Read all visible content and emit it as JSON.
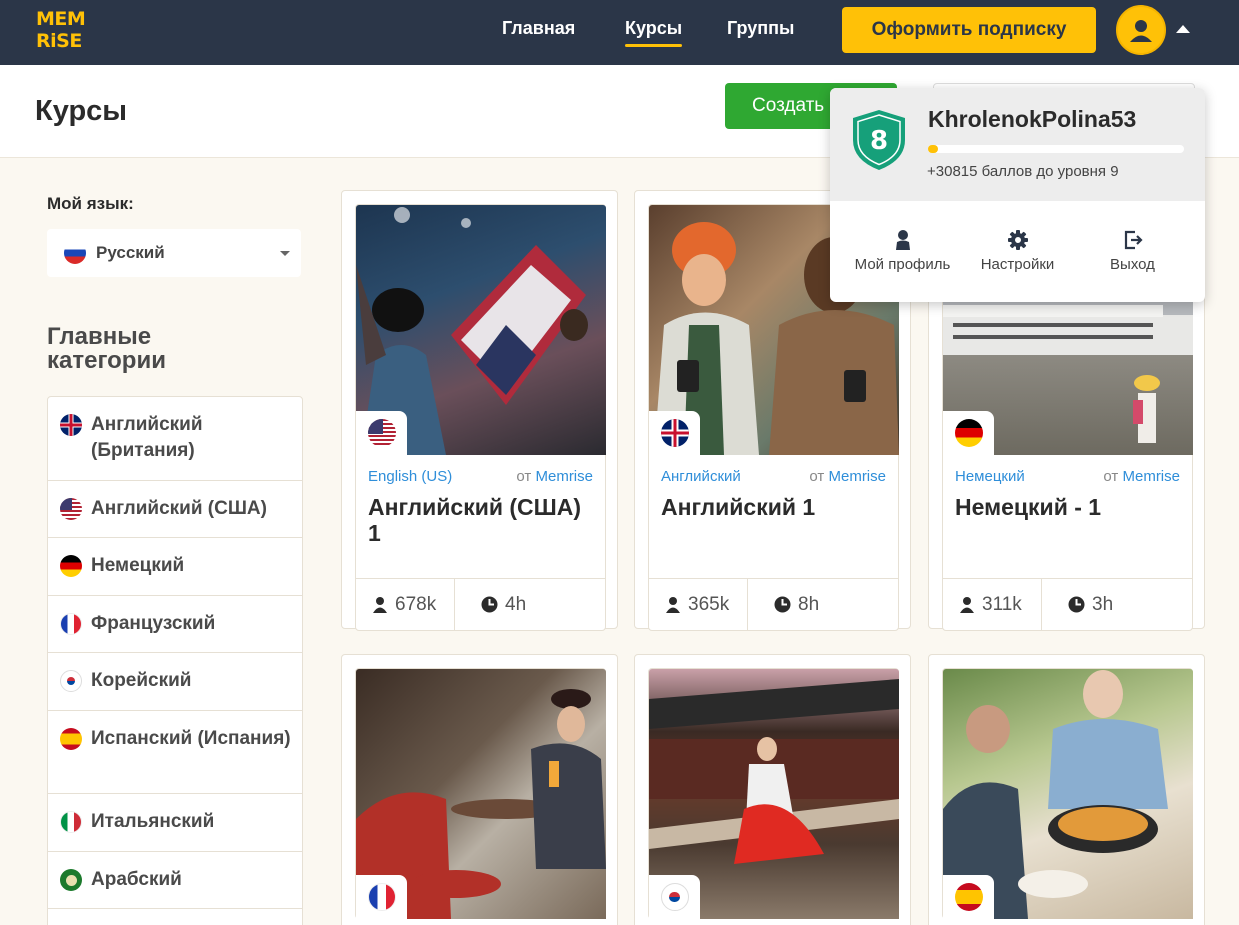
{
  "app": {
    "logo_text_line1": "MEM",
    "logo_text_line2": "RiSE",
    "nav": [
      {
        "label": "Главная",
        "active": false
      },
      {
        "label": "Курсы",
        "active": true
      },
      {
        "label": "Группы",
        "active": false
      }
    ],
    "subscribe_label": "Оформить подписку"
  },
  "page": {
    "title": "Курсы",
    "create_label": "Создать"
  },
  "sidebar": {
    "my_language_label": "Мой язык:",
    "selected_language": "Русский",
    "categories_title": "Главные категории",
    "categories": [
      {
        "label": "Английский (Британия)",
        "flag": "gb"
      },
      {
        "label": "Английский (США)",
        "flag": "us"
      },
      {
        "label": "Немецкий",
        "flag": "de"
      },
      {
        "label": "Французский",
        "flag": "fr"
      },
      {
        "label": "Корейский",
        "flag": "kr"
      },
      {
        "label": "Испанский (Испания)",
        "flag": "es"
      },
      {
        "label": "Итальянский",
        "flag": "it"
      },
      {
        "label": "Арабский",
        "flag": "ar"
      }
    ]
  },
  "courses": [
    {
      "category": "English (US)",
      "by_prefix": "от",
      "author": "Memrise",
      "name": "Английский (США) 1",
      "learners": "678k",
      "duration": "4h",
      "flag": "us"
    },
    {
      "category": "Английский",
      "by_prefix": "от",
      "author": "Memrise",
      "name": "Английский 1",
      "learners": "365k",
      "duration": "8h",
      "flag": "gb"
    },
    {
      "category": "Немецкий",
      "by_prefix": "от",
      "author": "Memrise",
      "name": "Немецкий - 1",
      "learners": "311k",
      "duration": "3h",
      "flag": "de"
    },
    {
      "flag": "fr"
    },
    {
      "flag": "kr"
    },
    {
      "flag": "es"
    }
  ],
  "profile_dropdown": {
    "level": "8",
    "username": "KhrolenokPolina53",
    "points_text": "+30815 баллов до уровня 9",
    "progress_fraction": 0.03,
    "actions": [
      {
        "label": "Мой профиль",
        "icon": "person-icon"
      },
      {
        "label": "Настройки",
        "icon": "gear-icon"
      },
      {
        "label": "Выход",
        "icon": "logout-icon"
      }
    ]
  },
  "colors": {
    "topbar": "#2b3648",
    "accent": "#ffc107",
    "create_button": "#2fa832",
    "link": "#2f8ed9",
    "level_shield": "#16a07a"
  }
}
